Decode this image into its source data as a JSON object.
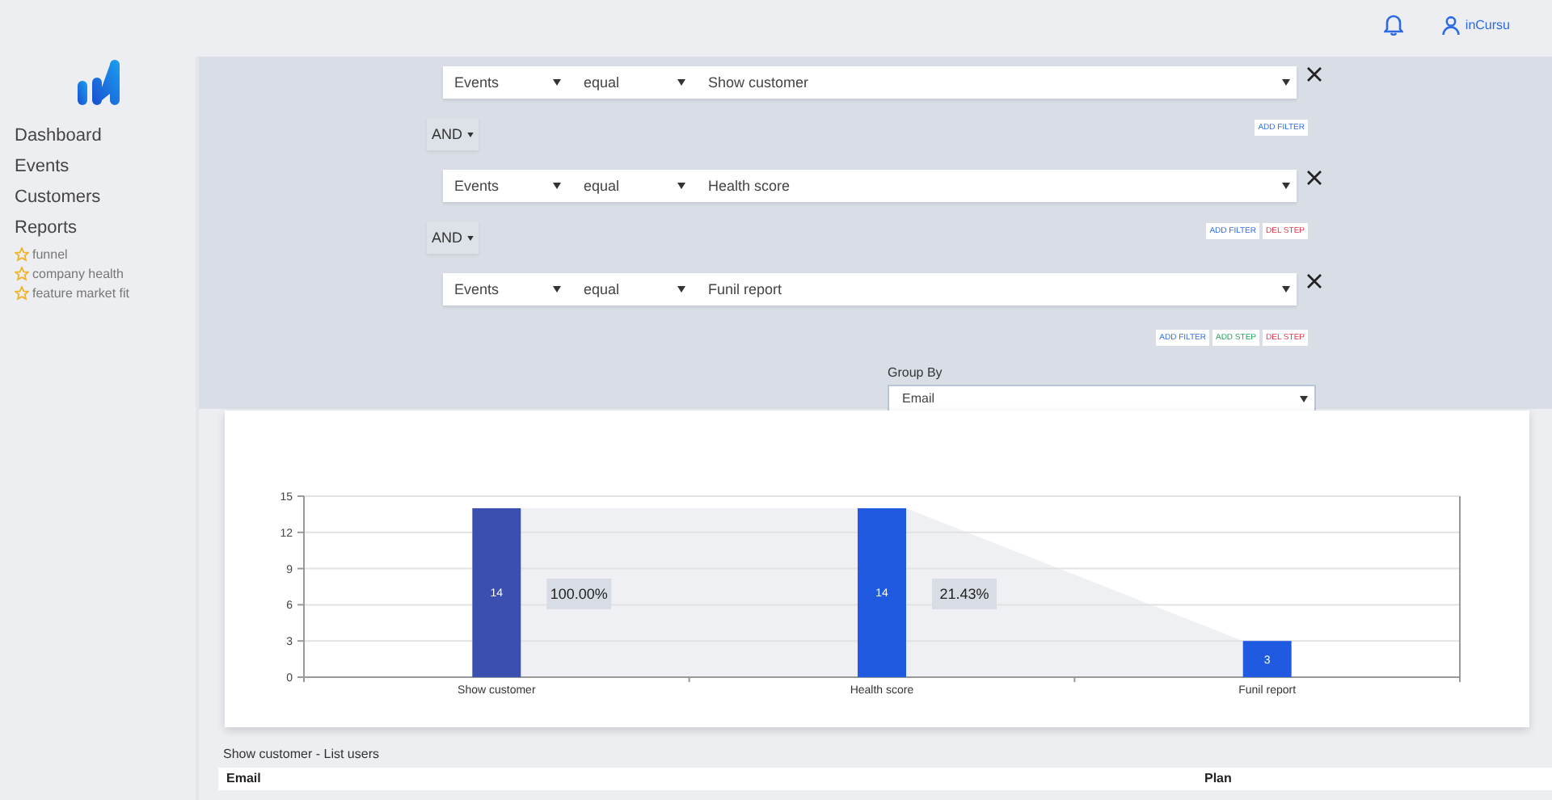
{
  "header": {
    "user": "inCursu"
  },
  "sidebar": {
    "items": [
      {
        "label": "Dashboard"
      },
      {
        "label": "Events"
      },
      {
        "label": "Customers"
      },
      {
        "label": "Reports"
      }
    ],
    "reports": [
      {
        "label": "funnel"
      },
      {
        "label": "company health"
      },
      {
        "label": "feature market fit"
      }
    ]
  },
  "steps": [
    {
      "field": "Events",
      "operator": "equal",
      "value": "Show customer",
      "connector": "AND",
      "actions": [
        {
          "kind": "add_filter",
          "label": "ADD FILTER"
        }
      ]
    },
    {
      "field": "Events",
      "operator": "equal",
      "value": "Health score",
      "connector": "AND",
      "actions": [
        {
          "kind": "add_filter",
          "label": "ADD FILTER"
        },
        {
          "kind": "del_step",
          "label": "DEL STEP"
        }
      ]
    },
    {
      "field": "Events",
      "operator": "equal",
      "value": "Funil report",
      "actions": [
        {
          "kind": "add_filter",
          "label": "ADD FILTER"
        },
        {
          "kind": "add_step",
          "label": "ADD STEP"
        },
        {
          "kind": "del_step",
          "label": "DEL STEP"
        }
      ]
    }
  ],
  "group_by": {
    "label": "Group By",
    "value": "Email"
  },
  "chart": {
    "chart_data": {
      "type": "bar",
      "categories": [
        "Show customer",
        "Health score",
        "Funil report"
      ],
      "series": [
        {
          "color": "#3b4fb0",
          "values": [
            14,
            null,
            null
          ]
        },
        {
          "color": "#1f5ae0",
          "values": [
            null,
            14,
            3
          ]
        }
      ],
      "grid": true,
      "ylim": [
        0,
        15
      ],
      "yticks": [
        0,
        3,
        6,
        9,
        12,
        15
      ],
      "data_labels": true,
      "annotations": [
        "100.00%",
        "21.43%"
      ]
    }
  },
  "list_title": "Show customer - List users",
  "table": {
    "columns": [
      "Email",
      "Plan"
    ]
  }
}
